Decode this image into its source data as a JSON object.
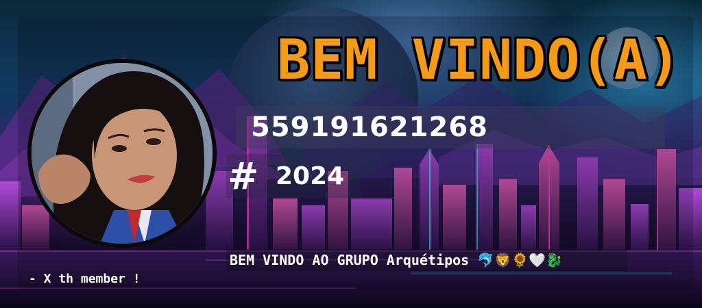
{
  "card": {
    "title": "BEM VINDO(A)",
    "member_id": "559191621268",
    "hash_symbol": "#",
    "year": "2024",
    "welcome_message": "BEM VINDO AO GRUPO Arquétipos 🐬🦁🌻🤍🐉",
    "member_count": "- X th member !"
  },
  "colors": {
    "title": "#f59a12",
    "title_outline": "#000000",
    "text": "#ffffff",
    "neon_pink": "#ff3cc8",
    "neon_cyan": "#3ce6ff"
  },
  "avatar": {
    "icon": "avatar-photo"
  }
}
